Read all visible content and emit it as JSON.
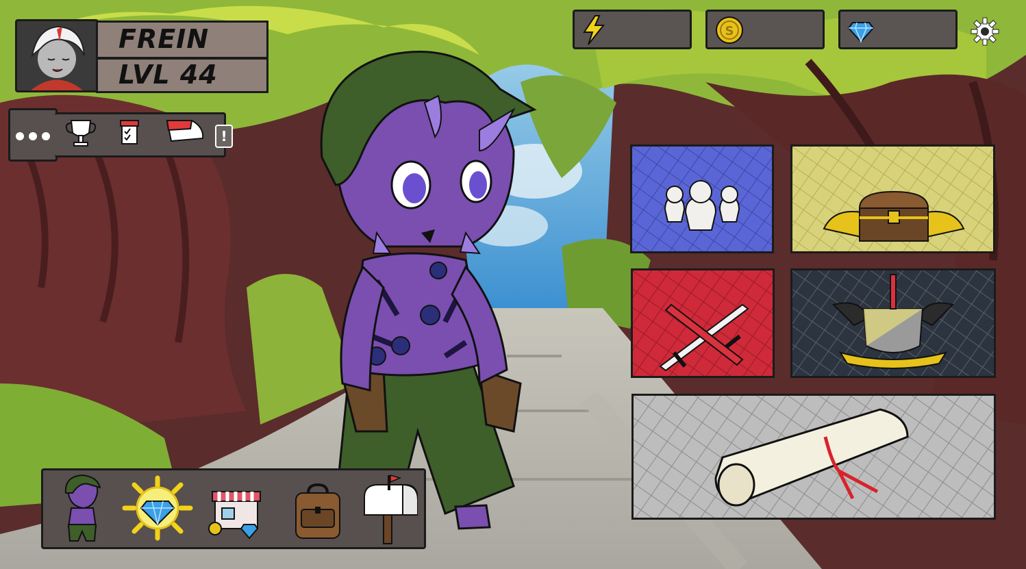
{
  "player": {
    "name": "FREIN",
    "level_label": "LVL 44"
  },
  "currencies": [
    {
      "icon": "lightning-icon",
      "value": ""
    },
    {
      "icon": "coin-icon",
      "value": ""
    },
    {
      "icon": "diamond-icon",
      "value": ""
    }
  ],
  "quick_menu": {
    "more_icon": "more-dots-icon",
    "items": [
      "trophy-icon",
      "checklist-icon",
      "news-icon"
    ],
    "alert_glyph": "!"
  },
  "main_tiles": [
    {
      "icon": "party-icon",
      "color": "#5a66d6"
    },
    {
      "icon": "treasure-chest-icon",
      "color": "#d8d27a"
    },
    {
      "icon": "crossed-swords-icon",
      "color": "#cf2a3a"
    },
    {
      "icon": "guild-crest-icon",
      "color": "#2c3440"
    },
    {
      "icon": "scroll-icon",
      "color": "#bdbdbd"
    }
  ],
  "bottom_nav": [
    "character-icon",
    "diamond-shop-icon",
    "store-icon",
    "backpack-icon",
    "mailbox-icon"
  ],
  "colors": {
    "panel": "#57504e",
    "plate": "#8f8079",
    "accent_purple": "#7a4fb0"
  }
}
